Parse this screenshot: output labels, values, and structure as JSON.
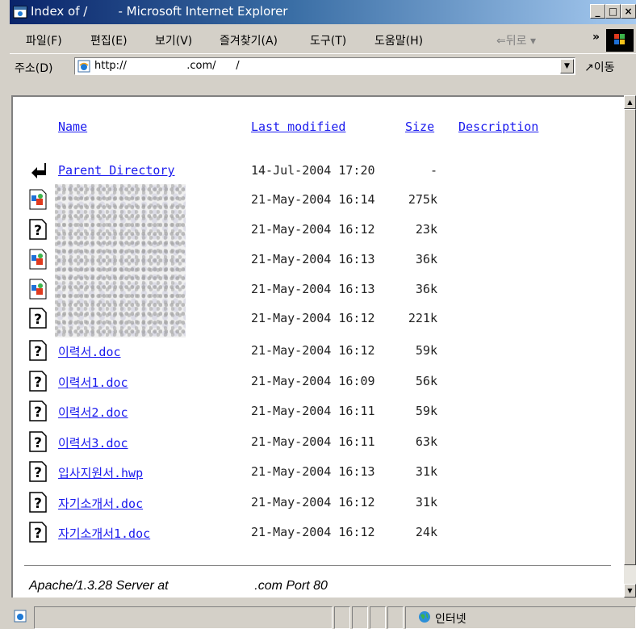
{
  "window": {
    "title": "Index of /        - Microsoft Internet Explorer",
    "buttons": {
      "minimize": "_",
      "maximize": "□",
      "close": "×"
    }
  },
  "menubar": {
    "items": [
      "파일(F)",
      "편집(E)",
      "보기(V)",
      "즐겨찾기(A)",
      "도구(T)",
      "도움말(H)"
    ],
    "back": "⇐뒤로 ▾",
    "chevron": "»"
  },
  "addressbar": {
    "label": "주소(D)",
    "value": "http://                  .com/      /",
    "go": "이동"
  },
  "listing": {
    "headers": {
      "name": "Name",
      "modified": "Last modified",
      "size": "Size",
      "description": "Description"
    },
    "rows": [
      {
        "icon": "back-arrow-icon",
        "name": "Parent Directory",
        "modified": "14-Jul-2004 17:20",
        "size": "-",
        "redacted": false
      },
      {
        "icon": "image-file-icon",
        "name": "",
        "modified": "21-May-2004 16:14",
        "size": "275k",
        "redacted": true
      },
      {
        "icon": "unknown-file-icon",
        "name": "",
        "modified": "21-May-2004 16:12",
        "size": "23k",
        "redacted": true
      },
      {
        "icon": "image-file-icon",
        "name": "",
        "modified": "21-May-2004 16:13",
        "size": "36k",
        "redacted": true
      },
      {
        "icon": "image-file-icon",
        "name": "",
        "modified": "21-May-2004 16:13",
        "size": "36k",
        "redacted": true
      },
      {
        "icon": "unknown-file-icon",
        "name": "",
        "modified": "21-May-2004 16:12",
        "size": "221k",
        "redacted": true
      },
      {
        "icon": "unknown-file-icon",
        "name": "이력서.doc",
        "modified": "21-May-2004 16:12",
        "size": "59k",
        "redacted": false
      },
      {
        "icon": "unknown-file-icon",
        "name": "이력서1.doc",
        "modified": "21-May-2004 16:09",
        "size": "56k",
        "redacted": false
      },
      {
        "icon": "unknown-file-icon",
        "name": "이력서2.doc",
        "modified": "21-May-2004 16:11",
        "size": "59k",
        "redacted": false
      },
      {
        "icon": "unknown-file-icon",
        "name": "이력서3.doc",
        "modified": "21-May-2004 16:11",
        "size": "63k",
        "redacted": false
      },
      {
        "icon": "unknown-file-icon",
        "name": "입사지원서.hwp",
        "modified": "21-May-2004 16:13",
        "size": "31k",
        "redacted": false
      },
      {
        "icon": "unknown-file-icon",
        "name": "자기소개서.doc",
        "modified": "21-May-2004 16:12",
        "size": "31k",
        "redacted": false
      },
      {
        "icon": "unknown-file-icon",
        "name": "자기소개서1.doc",
        "modified": "21-May-2004 16:12",
        "size": "24k",
        "redacted": false
      }
    ]
  },
  "footer": {
    "server_signature": "Apache/1.3.28 Server at                        .com Port 80"
  },
  "statusbar": {
    "zone": "인터넷"
  },
  "colors": {
    "link": "#1a1aee",
    "titlebar": "#0a246a",
    "chrome": "#d4d0c8",
    "signature_underline": "#e21a1a"
  }
}
